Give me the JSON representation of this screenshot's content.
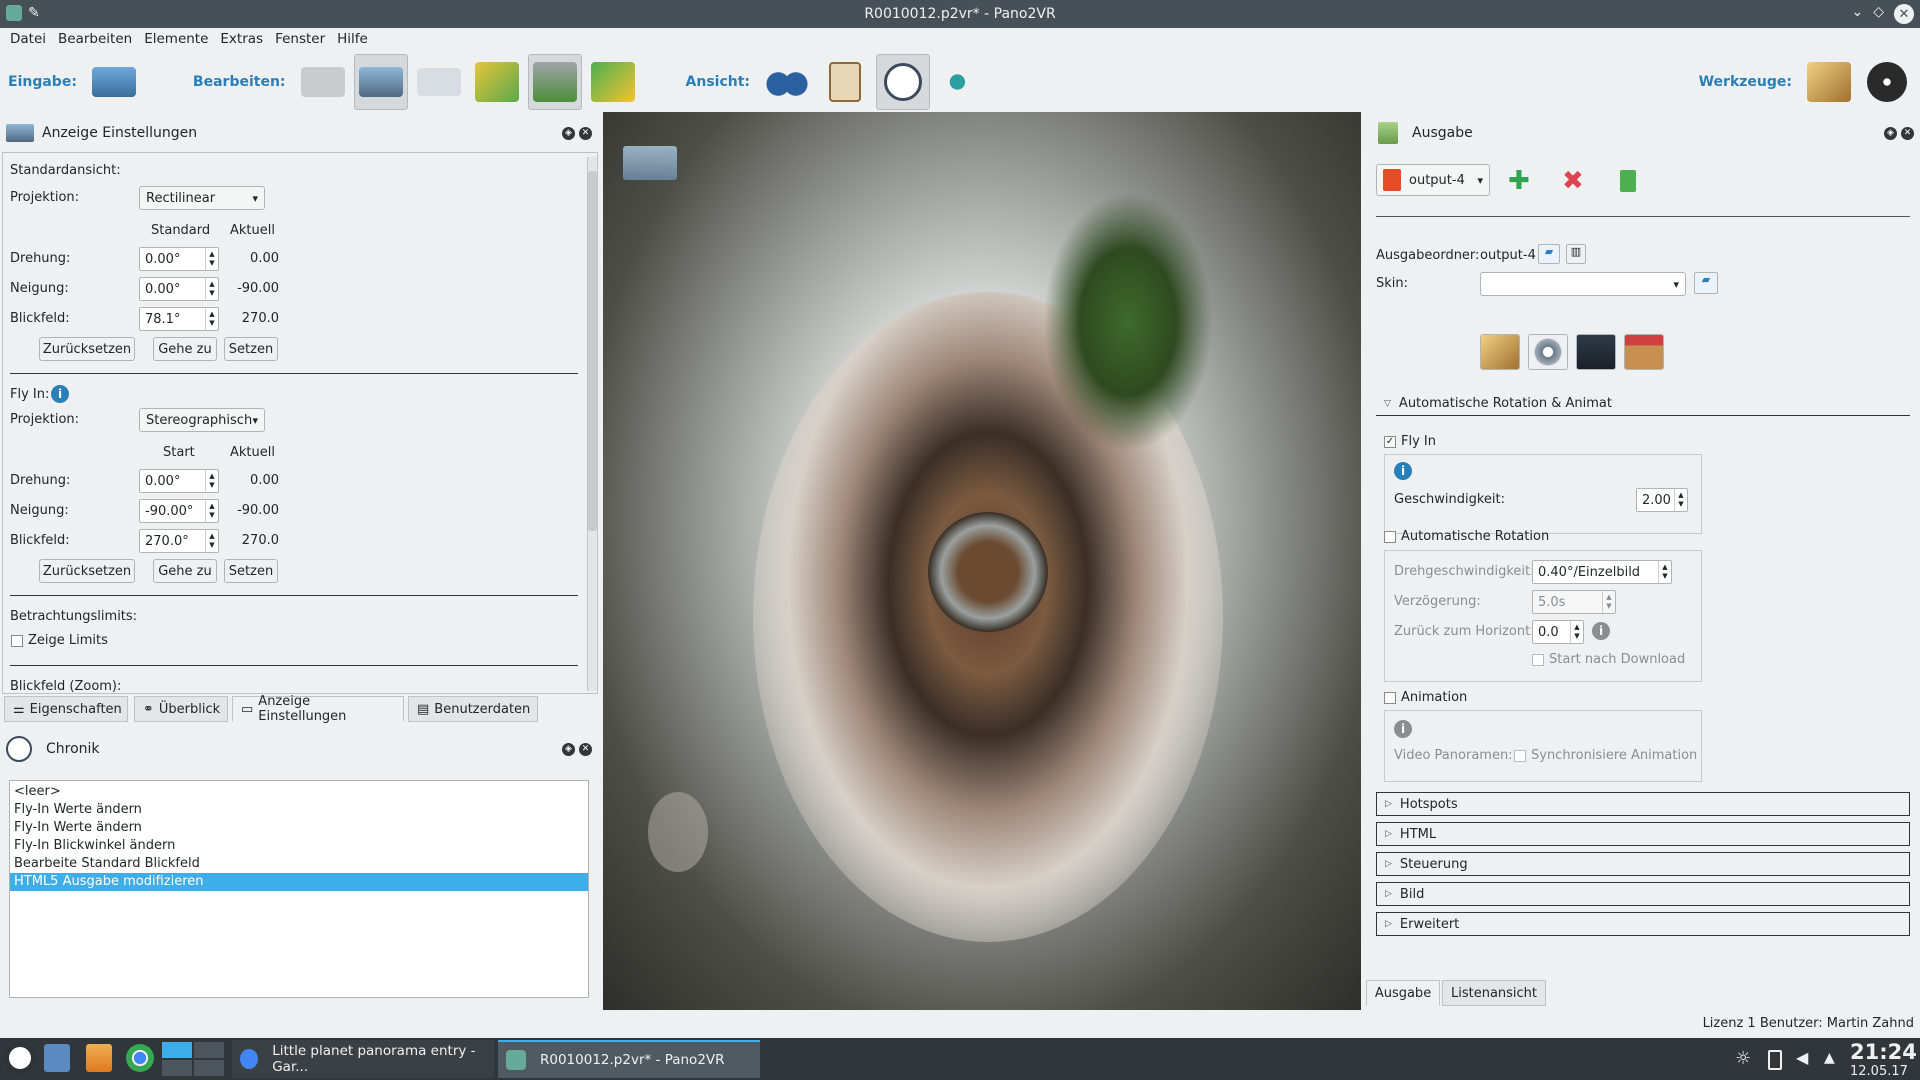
{
  "window": {
    "title": "R0010012.p2vr* - Pano2VR"
  },
  "menu": [
    "Datei",
    "Bearbeiten",
    "Elemente",
    "Extras",
    "Fenster",
    "Hilfe"
  ],
  "toolbar": {
    "input_label": "Eingabe:",
    "edit_label": "Bearbeiten:",
    "view_label": "Ansicht:",
    "tools_label": "Werkzeuge:"
  },
  "left_panel": {
    "title": "Anzeige Einstellungen",
    "standard_view_label": "Standardansicht:",
    "projection_label": "Projektion:",
    "projection_value": "Rectilinear",
    "col_standard": "Standard",
    "col_current": "Aktuell",
    "pan_label": "Drehung:",
    "pan_value": "0.00°",
    "pan_current": "0.00",
    "tilt_label": "Neigung:",
    "tilt_value": "0.00°",
    "tilt_current": "-90.00",
    "fov_label": "Blickfeld:",
    "fov_value": "78.1°",
    "fov_current": "270.0",
    "reset": "Zurücksetzen",
    "goto": "Gehe zu",
    "set": "Setzen",
    "flyin_label": "Fly In:",
    "flyin_projection_value": "Stereographisch",
    "col_start": "Start",
    "fi_pan_value": "0.00°",
    "fi_pan_current": "0.00",
    "fi_tilt_value": "-90.00°",
    "fi_tilt_current": "-90.00",
    "fi_fov_value": "270.0°",
    "fi_fov_current": "270.0",
    "limits_label": "Betrachtungslimits:",
    "show_limits": "Zeige Limits",
    "zoom_label": "Blickfeld (Zoom):"
  },
  "left_tabs": [
    "Eigenschaften",
    "Überblick",
    "Anzeige Einstellungen",
    "Benutzerdaten"
  ],
  "history": {
    "title": "Chronik",
    "items": [
      "<leer>",
      "Fly-In Werte ändern",
      "Fly-In Werte ändern",
      "Fly-In Blickwinkel ändern",
      "Bearbeite Standard Blickfeld",
      "HTML5 Ausgabe modifizieren"
    ]
  },
  "right_panel": {
    "title": "Ausgabe",
    "output_name": "output-4",
    "folder_label": "Ausgabeordner:",
    "folder_value": "output-4",
    "skin_label": "Skin:",
    "section_autorot": "Automatische Rotation & Animat",
    "flyin_cb": "Fly In",
    "speed_label": "Geschwindigkeit:",
    "speed_value": "2.00",
    "autorot_cb": "Automatische Rotation",
    "rot_speed_label": "Drehgeschwindigkeit:",
    "rot_speed_value": "0.40°/Einzelbild",
    "delay_label": "Verzögerung:",
    "delay_value": "5.0s",
    "horizon_label": "Zurück zum Horizont:",
    "horizon_value": "0.0",
    "start_dl": "Start nach Download",
    "anim_cb": "Animation",
    "video_label": "Video Panoramen:",
    "sync_anim": "Synchronisiere Animation",
    "sections": [
      "Hotspots",
      "HTML",
      "Steuerung",
      "Bild",
      "Erweitert"
    ]
  },
  "right_tabs": [
    "Ausgabe",
    "Listenansicht"
  ],
  "status": "Lizenz 1 Benutzer: Martin Zahnd",
  "taskbar": {
    "task1": "Little planet panorama entry - Gar...",
    "task2": "R0010012.p2vr* - Pano2VR",
    "time": "21:24",
    "date": "12.05.17"
  },
  "colors": {
    "accent": "#3daee9",
    "titlebar": "#475057",
    "label_blue": "#2980b9"
  }
}
